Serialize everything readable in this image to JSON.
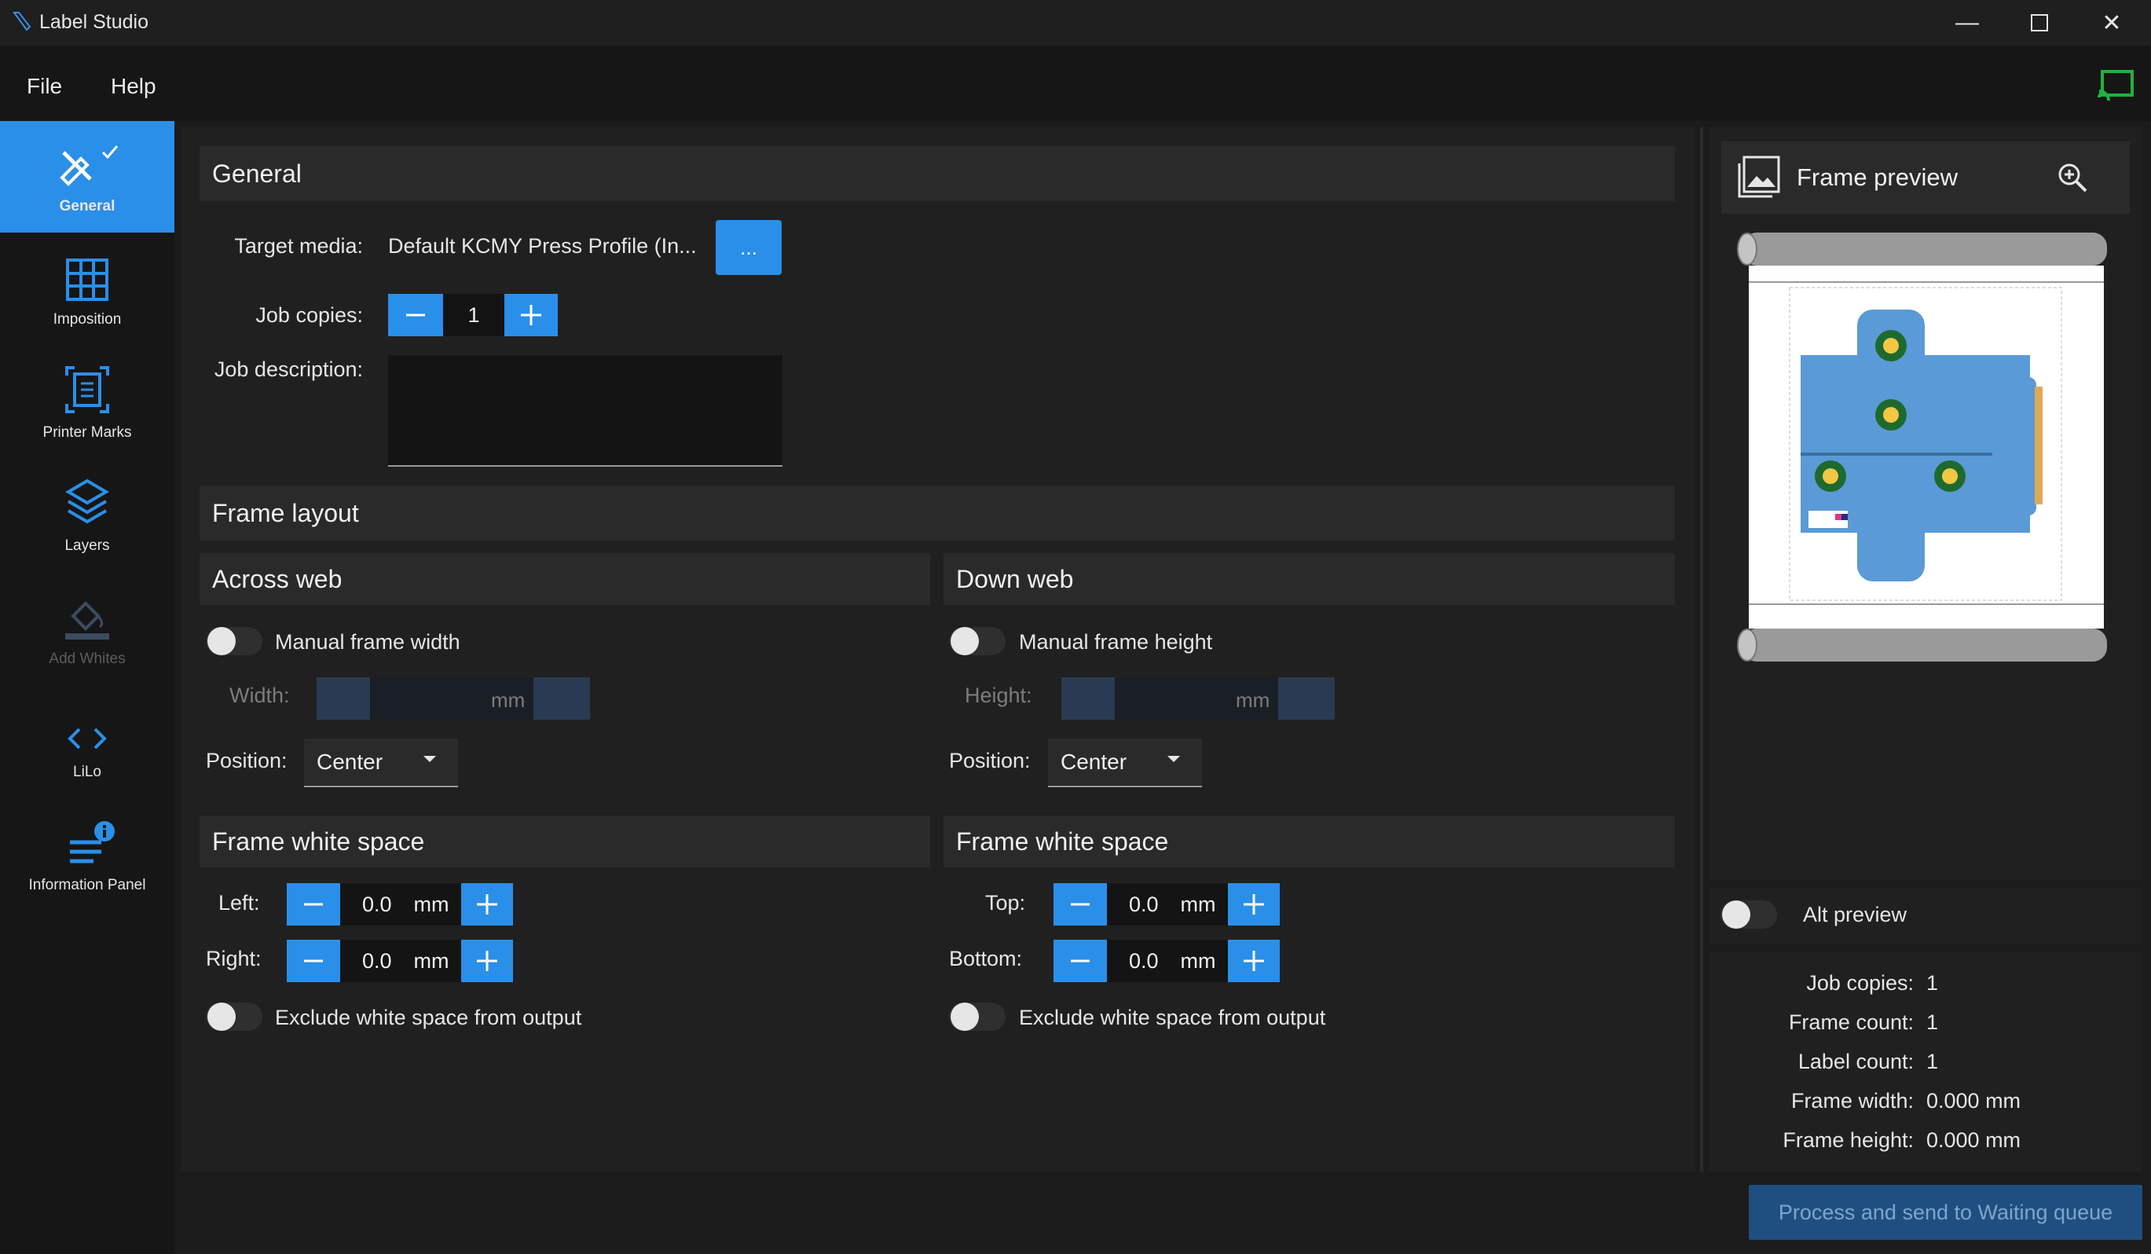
{
  "window": {
    "title": "Label Studio"
  },
  "menu": {
    "file": "File",
    "help": "Help"
  },
  "sidebar": {
    "items": [
      {
        "label": "General"
      },
      {
        "label": "Imposition"
      },
      {
        "label": "Printer Marks"
      },
      {
        "label": "Layers"
      },
      {
        "label": "Add Whites"
      },
      {
        "label": "LiLo"
      },
      {
        "label": "Information Panel"
      }
    ]
  },
  "general": {
    "heading": "General",
    "target_media_label": "Target media:",
    "target_media_value": "Default KCMY Press Profile (In...",
    "browse_label": "...",
    "job_copies_label": "Job copies:",
    "job_copies_value": "1",
    "job_description_label": "Job description:"
  },
  "frame_layout": {
    "heading": "Frame layout",
    "across": {
      "heading": "Across web",
      "manual_label": "Manual frame width",
      "width_label": "Width:",
      "unit": "mm",
      "position_label": "Position:",
      "position_value": "Center",
      "whitespace_heading": "Frame white space",
      "left_label": "Left:",
      "left_value": "0.0",
      "right_label": "Right:",
      "right_value": "0.0",
      "exclude_label": "Exclude white space from output"
    },
    "down": {
      "heading": "Down web",
      "manual_label": "Manual frame height",
      "height_label": "Height:",
      "unit": "mm",
      "position_label": "Position:",
      "position_value": "Center",
      "whitespace_heading": "Frame white space",
      "top_label": "Top:",
      "top_value": "0.0",
      "bottom_label": "Bottom:",
      "bottom_value": "0.0",
      "exclude_label": "Exclude white space from output"
    }
  },
  "preview": {
    "title": "Frame preview",
    "alt_preview_label": "Alt preview",
    "info": [
      {
        "key": "Job copies:",
        "value": "1"
      },
      {
        "key": "Frame count:",
        "value": "1"
      },
      {
        "key": "Label count:",
        "value": "1"
      },
      {
        "key": "Frame width:",
        "value": "0.000 mm"
      },
      {
        "key": "Frame height:",
        "value": "0.000 mm"
      }
    ]
  },
  "footer": {
    "process_button": "Process and send to Waiting queue"
  },
  "colors": {
    "accent": "#2a8fe8",
    "background": "#1b1b1b",
    "panel": "#202020"
  }
}
